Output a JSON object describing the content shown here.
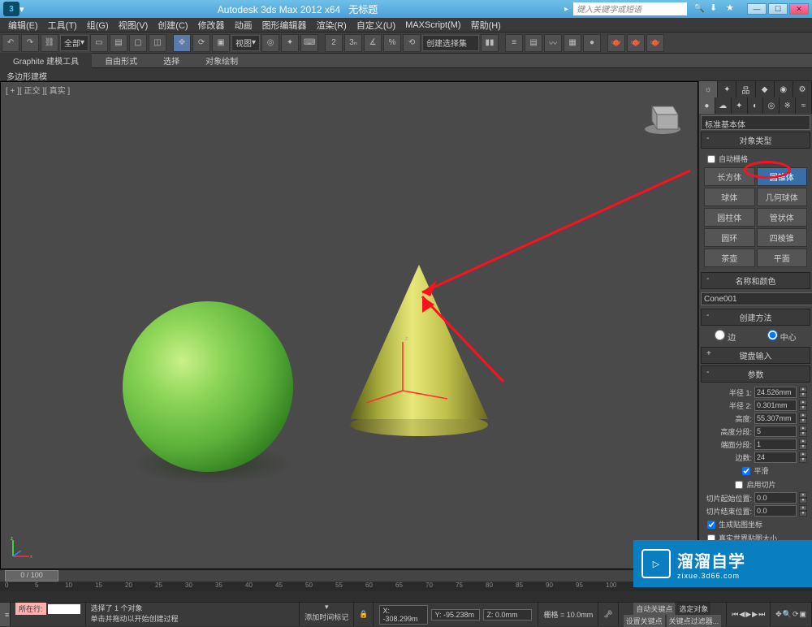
{
  "title": {
    "app": "Autodesk 3ds Max  2012 x64",
    "doc": "无标题"
  },
  "search_placeholder": "键入关键字或短语",
  "menus": [
    "编辑(E)",
    "工具(T)",
    "组(G)",
    "视图(V)",
    "创建(C)",
    "修改器",
    "动画",
    "图形编辑器",
    "渲染(R)",
    "自定义(U)",
    "MAXScript(M)",
    "帮助(H)"
  ],
  "toolbar_dropdowns": {
    "slot1": "全部",
    "slot2": "视图",
    "slot3": "创建选择集"
  },
  "ribbon_tabs": [
    "Graphite 建模工具",
    "自由形式",
    "选择",
    "对象绘制"
  ],
  "polyrow": "多边形建模",
  "viewport_label": "[ + ][ 正交 ][ 真实 ]",
  "panel_tabs_row1": [
    "☼",
    "✦",
    "品",
    "◆",
    "◉",
    "⚙"
  ],
  "panel_tabs_row2": [
    "●",
    "☁",
    "✦",
    "◐",
    "◎",
    "※",
    "≈"
  ],
  "primitive_dropdown": "标准基本体",
  "rollouts": {
    "object_type": "对象类型",
    "autogrid": "自动栅格",
    "name_color": "名称和颜色",
    "create_method": "创建方法",
    "keyboard_entry": "键盘输入",
    "parameters": "参数"
  },
  "primitives": [
    [
      "长方体",
      "圆锥体"
    ],
    [
      "球体",
      "几何球体"
    ],
    [
      "圆柱体",
      "管状体"
    ],
    [
      "圆环",
      "四棱锥"
    ],
    [
      "茶壶",
      "平面"
    ]
  ],
  "object_name": "Cone001",
  "create_method_opts": {
    "edge": "边",
    "center": "中心"
  },
  "params": {
    "radius1": {
      "label": "半径 1:",
      "val": "24.526mm"
    },
    "radius2": {
      "label": "半径 2:",
      "val": "0.301mm"
    },
    "height": {
      "label": "高度:",
      "val": "55.307mm"
    },
    "hsegs": {
      "label": "高度分段:",
      "val": "5"
    },
    "csegs": {
      "label": "端面分段:",
      "val": "1"
    },
    "sides": {
      "label": "边数:",
      "val": "24"
    },
    "smooth": "平滑",
    "slice_on": "启用切片",
    "slice_from": {
      "label": "切片起始位置:",
      "val": "0.0"
    },
    "slice_to": {
      "label": "切片结束位置:",
      "val": "0.0"
    },
    "gen_uv": "生成贴图坐标",
    "real_uv": "真实世界贴图大小"
  },
  "timeline": {
    "thumb": "0 / 100",
    "ticks": [
      0,
      5,
      10,
      15,
      20,
      25,
      30,
      35,
      40,
      45,
      50,
      55,
      60,
      65,
      70,
      75,
      80,
      85,
      90,
      95,
      100
    ]
  },
  "status": {
    "sel": "选择了 1 个对象",
    "hint": "单击并拖动以开始创建过程",
    "add_time": "添加时间标记",
    "x": "X: -308.299m",
    "y": "Y: -95.238m",
    "z": "Z: 0.0mm",
    "grid": "栅格 = 10.0mm",
    "autokey": "自动关键点",
    "selset": "选定对象",
    "setkey": "设置关键点",
    "filter": "关键点过滤器..."
  },
  "prompt_label": "所在行:",
  "watermark": {
    "brand": "溜溜自学",
    "url": "zixue.3d66.com"
  }
}
